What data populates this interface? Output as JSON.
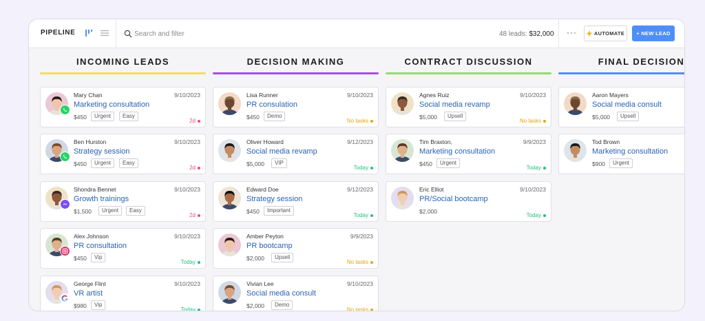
{
  "header": {
    "title": "PIPELINE",
    "search_placeholder": "Search and filter",
    "leads_count": "48 leads:",
    "leads_total": "$32,000",
    "more": "···",
    "automate_label": "AUTOMATE",
    "new_lead_label": "+ NEW LEAD"
  },
  "colors": {
    "accent": "#4f8ef7",
    "link": "#2a62b4",
    "overdue": "#ec4a78",
    "notasks": "#e3a413",
    "today": "#1ec27a"
  },
  "columns": [
    {
      "title": "INCOMING LEADS",
      "color": "#f2dd5a",
      "cards": [
        {
          "name": "Mary Chan",
          "date": "9/10/2023",
          "deal": "Marketing consultation",
          "price": "$450",
          "tags": [
            "Urgent",
            "Easy"
          ],
          "status": "2d",
          "source_icon": "whatsapp-icon"
        },
        {
          "name": "Ben Hurston",
          "date": "9/10/2023",
          "deal": "Strategy session",
          "price": "$450",
          "tags": [
            "Urgent",
            "Easy"
          ],
          "status": "2d",
          "source_icon": "whatsapp-icon"
        },
        {
          "name": "Shondra Bennet",
          "date": "9/10/2023",
          "deal": "Growth trainings",
          "price": "$1,500",
          "tags": [
            "Urgent",
            "Easy"
          ],
          "status": "2d",
          "source_icon": "messenger-icon"
        },
        {
          "name": "Alex Johnson",
          "date": "9/10/2023",
          "deal": "PR consultation",
          "price": "$450",
          "tags": [
            "Vip"
          ],
          "status": "Today",
          "source_icon": "instagram-icon"
        },
        {
          "name": "George Flint",
          "date": "9/10/2023",
          "deal": "VR artist",
          "price": "$980",
          "tags": [
            "Vip"
          ],
          "status": "Today",
          "source_icon": "google-icon"
        }
      ]
    },
    {
      "title": "DECISION MAKING",
      "color": "#a64be8",
      "cards": [
        {
          "name": "Lisa Runner",
          "date": "9/10/2023",
          "deal": "PR consulation",
          "price": "$450",
          "tags": [
            "Demo"
          ],
          "status": "No tasks"
        },
        {
          "name": "Oliver Howard",
          "date": "9/12/2023",
          "deal": "Social media revamp",
          "price": "$5,000",
          "tags": [
            "VIP"
          ],
          "status": "Today"
        },
        {
          "name": "Edward Doe",
          "date": "9/12/2023",
          "deal": "Strategy session",
          "price": "$450",
          "tags": [
            "Important"
          ],
          "status": "Today"
        },
        {
          "name": "Amber Peyton",
          "date": "9/9/2023",
          "deal": "PR bootcamp",
          "price": "$2,000",
          "tags": [
            "Upsell"
          ],
          "status": "No tasks"
        },
        {
          "name": "Vivian Lee",
          "date": "9/10/2023",
          "deal": "Social media consult",
          "price": "$2,000",
          "tags": [
            "Demo"
          ],
          "status": "No tasks"
        }
      ]
    },
    {
      "title": "CONTRACT DISCUSSION",
      "color": "#92dd63",
      "cards": [
        {
          "name": "Agnes Ruiz",
          "date": "9/10/2023",
          "deal": "Social media revamp",
          "price": "$5,000",
          "tags": [
            "Upsell"
          ],
          "status": "No tasks"
        },
        {
          "name": "Tim Braxton,",
          "date": "9/9/2023",
          "deal": "Marketing consultation",
          "price": "$450",
          "tags": [
            "Urgent"
          ],
          "status": "Today"
        },
        {
          "name": "Eric Elliot",
          "date": "9/10/2023",
          "deal": "PR/Social bootcamp",
          "price": "$2,000",
          "tags": [],
          "status": "Today"
        }
      ]
    },
    {
      "title": "FINAL DECISION",
      "color": "#4f8ef7",
      "cards": [
        {
          "name": "Aaron Mayers",
          "date": "",
          "deal": "Social media consult",
          "price": "$5,000",
          "tags": [
            "Upsell"
          ],
          "status": ""
        },
        {
          "name": "Tod Brown",
          "date": "",
          "deal": "Marketing consultation",
          "price": "$900",
          "tags": [
            "Urgent"
          ],
          "status": ""
        }
      ]
    }
  ]
}
